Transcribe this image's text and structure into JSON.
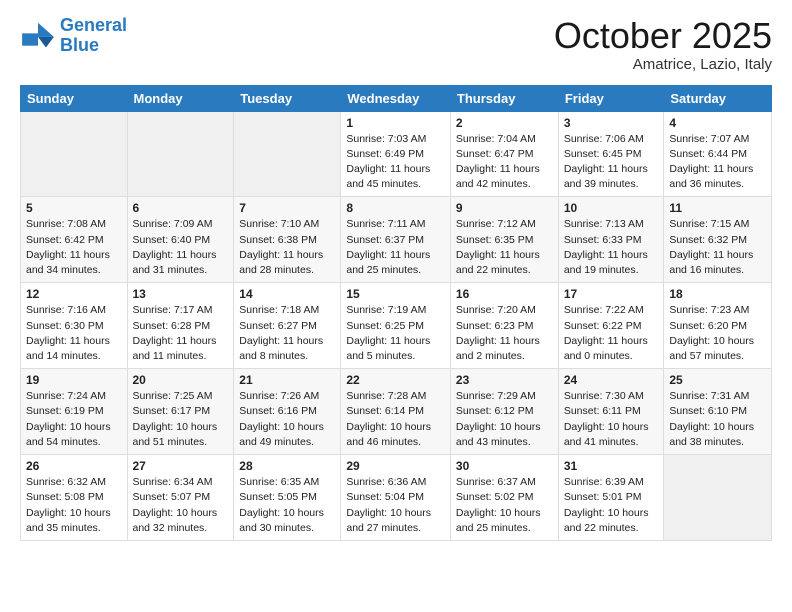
{
  "header": {
    "logo_text_general": "General",
    "logo_text_blue": "Blue",
    "month_title": "October 2025",
    "location": "Amatrice, Lazio, Italy"
  },
  "days_of_week": [
    "Sunday",
    "Monday",
    "Tuesday",
    "Wednesday",
    "Thursday",
    "Friday",
    "Saturday"
  ],
  "weeks": [
    [
      {
        "day": "",
        "info": ""
      },
      {
        "day": "",
        "info": ""
      },
      {
        "day": "",
        "info": ""
      },
      {
        "day": "1",
        "info": "Sunrise: 7:03 AM\nSunset: 6:49 PM\nDaylight: 11 hours\nand 45 minutes."
      },
      {
        "day": "2",
        "info": "Sunrise: 7:04 AM\nSunset: 6:47 PM\nDaylight: 11 hours\nand 42 minutes."
      },
      {
        "day": "3",
        "info": "Sunrise: 7:06 AM\nSunset: 6:45 PM\nDaylight: 11 hours\nand 39 minutes."
      },
      {
        "day": "4",
        "info": "Sunrise: 7:07 AM\nSunset: 6:44 PM\nDaylight: 11 hours\nand 36 minutes."
      }
    ],
    [
      {
        "day": "5",
        "info": "Sunrise: 7:08 AM\nSunset: 6:42 PM\nDaylight: 11 hours\nand 34 minutes."
      },
      {
        "day": "6",
        "info": "Sunrise: 7:09 AM\nSunset: 6:40 PM\nDaylight: 11 hours\nand 31 minutes."
      },
      {
        "day": "7",
        "info": "Sunrise: 7:10 AM\nSunset: 6:38 PM\nDaylight: 11 hours\nand 28 minutes."
      },
      {
        "day": "8",
        "info": "Sunrise: 7:11 AM\nSunset: 6:37 PM\nDaylight: 11 hours\nand 25 minutes."
      },
      {
        "day": "9",
        "info": "Sunrise: 7:12 AM\nSunset: 6:35 PM\nDaylight: 11 hours\nand 22 minutes."
      },
      {
        "day": "10",
        "info": "Sunrise: 7:13 AM\nSunset: 6:33 PM\nDaylight: 11 hours\nand 19 minutes."
      },
      {
        "day": "11",
        "info": "Sunrise: 7:15 AM\nSunset: 6:32 PM\nDaylight: 11 hours\nand 16 minutes."
      }
    ],
    [
      {
        "day": "12",
        "info": "Sunrise: 7:16 AM\nSunset: 6:30 PM\nDaylight: 11 hours\nand 14 minutes."
      },
      {
        "day": "13",
        "info": "Sunrise: 7:17 AM\nSunset: 6:28 PM\nDaylight: 11 hours\nand 11 minutes."
      },
      {
        "day": "14",
        "info": "Sunrise: 7:18 AM\nSunset: 6:27 PM\nDaylight: 11 hours\nand 8 minutes."
      },
      {
        "day": "15",
        "info": "Sunrise: 7:19 AM\nSunset: 6:25 PM\nDaylight: 11 hours\nand 5 minutes."
      },
      {
        "day": "16",
        "info": "Sunrise: 7:20 AM\nSunset: 6:23 PM\nDaylight: 11 hours\nand 2 minutes."
      },
      {
        "day": "17",
        "info": "Sunrise: 7:22 AM\nSunset: 6:22 PM\nDaylight: 11 hours\nand 0 minutes."
      },
      {
        "day": "18",
        "info": "Sunrise: 7:23 AM\nSunset: 6:20 PM\nDaylight: 10 hours\nand 57 minutes."
      }
    ],
    [
      {
        "day": "19",
        "info": "Sunrise: 7:24 AM\nSunset: 6:19 PM\nDaylight: 10 hours\nand 54 minutes."
      },
      {
        "day": "20",
        "info": "Sunrise: 7:25 AM\nSunset: 6:17 PM\nDaylight: 10 hours\nand 51 minutes."
      },
      {
        "day": "21",
        "info": "Sunrise: 7:26 AM\nSunset: 6:16 PM\nDaylight: 10 hours\nand 49 minutes."
      },
      {
        "day": "22",
        "info": "Sunrise: 7:28 AM\nSunset: 6:14 PM\nDaylight: 10 hours\nand 46 minutes."
      },
      {
        "day": "23",
        "info": "Sunrise: 7:29 AM\nSunset: 6:12 PM\nDaylight: 10 hours\nand 43 minutes."
      },
      {
        "day": "24",
        "info": "Sunrise: 7:30 AM\nSunset: 6:11 PM\nDaylight: 10 hours\nand 41 minutes."
      },
      {
        "day": "25",
        "info": "Sunrise: 7:31 AM\nSunset: 6:10 PM\nDaylight: 10 hours\nand 38 minutes."
      }
    ],
    [
      {
        "day": "26",
        "info": "Sunrise: 6:32 AM\nSunset: 5:08 PM\nDaylight: 10 hours\nand 35 minutes."
      },
      {
        "day": "27",
        "info": "Sunrise: 6:34 AM\nSunset: 5:07 PM\nDaylight: 10 hours\nand 32 minutes."
      },
      {
        "day": "28",
        "info": "Sunrise: 6:35 AM\nSunset: 5:05 PM\nDaylight: 10 hours\nand 30 minutes."
      },
      {
        "day": "29",
        "info": "Sunrise: 6:36 AM\nSunset: 5:04 PM\nDaylight: 10 hours\nand 27 minutes."
      },
      {
        "day": "30",
        "info": "Sunrise: 6:37 AM\nSunset: 5:02 PM\nDaylight: 10 hours\nand 25 minutes."
      },
      {
        "day": "31",
        "info": "Sunrise: 6:39 AM\nSunset: 5:01 PM\nDaylight: 10 hours\nand 22 minutes."
      },
      {
        "day": "",
        "info": ""
      }
    ]
  ]
}
